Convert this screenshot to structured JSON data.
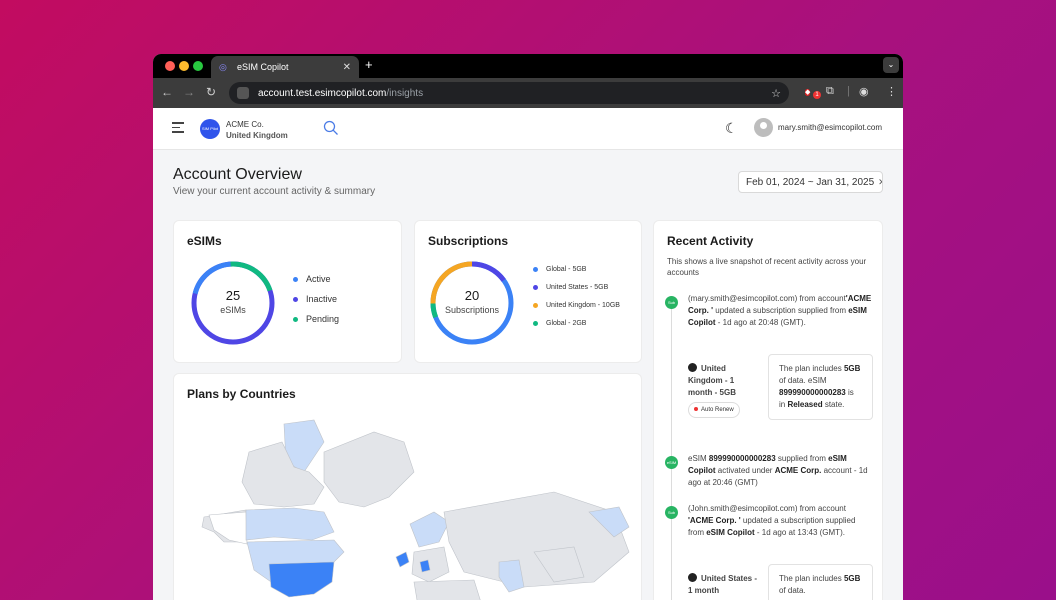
{
  "browser": {
    "tab_title": "eSIM Copilot",
    "url_domain": "account.test.esimcopilot.com",
    "url_path": "/insights",
    "extension_badge": "1"
  },
  "header": {
    "logo_text": "SIM Pilot",
    "company_name": "ACME Co.",
    "company_region": "United Kingdom",
    "user_email": "mary.smith@esimcopilot.com"
  },
  "page": {
    "title": "Account Overview",
    "subtitle": "View your current account activity & summary",
    "date_range": "Feb 01, 2024 ~ Jan 31, 2025"
  },
  "esims": {
    "title": "eSIMs",
    "count": "25",
    "count_label": "eSIMs",
    "legend": [
      {
        "label": "Active",
        "color": "#3b82f6"
      },
      {
        "label": "Inactive",
        "color": "#4f46e5"
      },
      {
        "label": "Pending",
        "color": "#10b981"
      }
    ]
  },
  "subscriptions": {
    "title": "Subscriptions",
    "count": "20",
    "count_label": "Subscriptions",
    "legend": [
      {
        "label": "Global - 5GB",
        "color": "#3b82f6"
      },
      {
        "label": "United States - 5GB",
        "color": "#4f46e5"
      },
      {
        "label": "United Kingdom - 10GB",
        "color": "#f5a623"
      },
      {
        "label": "Global - 2GB",
        "color": "#10b981"
      }
    ]
  },
  "plans_map": {
    "title": "Plans by Countries"
  },
  "activity": {
    "title": "Recent Activity",
    "subtitle": "This shows a live snapshot of recent activity across your accounts",
    "items": [
      {
        "badge": "Sub",
        "html_parts": [
          "(mary.smith@esimcopilot.com) from account",
          "'ACME Corp. '",
          " updated a subscription supplied from ",
          "eSIM Copilot",
          " - 1d ago at 20:48 (GMT)."
        ],
        "plan_name": "United Kingdom - 1 month - 5GB",
        "plan_pill": "Auto Renew",
        "detail_parts": [
          "The plan includes ",
          "5GB",
          " of data. eSIM ",
          "899990000000283",
          " is in ",
          "Released",
          " state."
        ]
      },
      {
        "badge": "eSIM",
        "html_parts": [
          "eSIM ",
          "899990000000283",
          " supplied from ",
          "eSIM Copilot",
          " activated under ",
          "ACME Corp.",
          " account - 1d ago at 20:46 (GMT)"
        ]
      },
      {
        "badge": "Sub",
        "html_parts": [
          "(John.smith@esimcopilot.com) from account ",
          "'ACME Corp. '",
          " updated a subscription supplied from ",
          "eSIM Copilot",
          " - 1d ago at 13:43 (GMT)."
        ],
        "plan_name": "United States - 1 month",
        "detail_parts": [
          "The plan includes ",
          "5GB",
          " of data."
        ]
      }
    ]
  }
}
